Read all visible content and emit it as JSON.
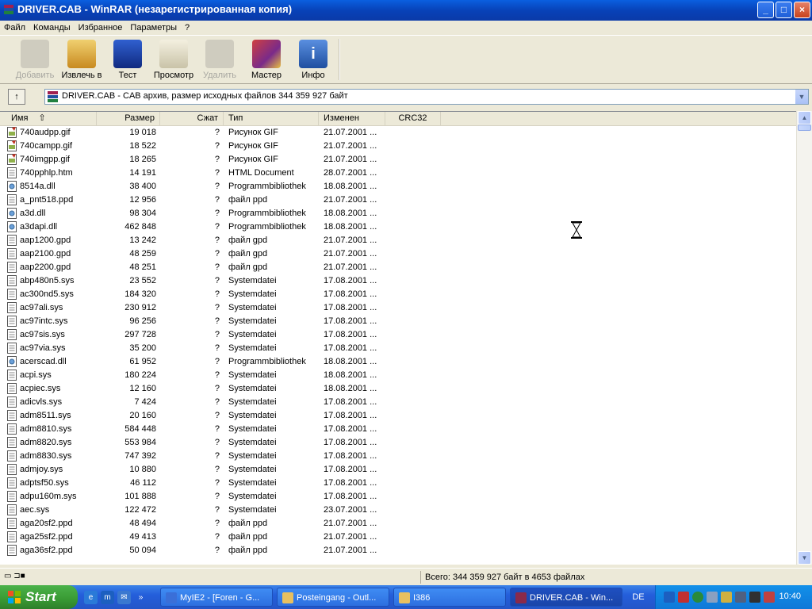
{
  "window": {
    "title": "DRIVER.CAB - WinRAR (незарегистрированная копия)",
    "controls": [
      "_",
      "□",
      "×"
    ]
  },
  "menu": [
    "Файл",
    "Команды",
    "Избранное",
    "Параметры",
    "?"
  ],
  "toolbar": [
    {
      "label": "Добавить",
      "icon": "add-archive-icon",
      "disabled": true,
      "color": "#b8b5a8"
    },
    {
      "label": "Извлечь в",
      "icon": "extract-icon",
      "disabled": false,
      "color": "#d89a2a"
    },
    {
      "label": "Тест",
      "icon": "test-icon",
      "disabled": false,
      "color": "#1a3da8"
    },
    {
      "label": "Просмотр",
      "icon": "view-icon",
      "disabled": false,
      "color": "#c9c3a8"
    },
    {
      "label": "Удалить",
      "icon": "delete-icon",
      "disabled": true,
      "color": "#b8b5a8"
    },
    {
      "label": "Мастер",
      "icon": "wizard-icon",
      "disabled": false,
      "color": "#7a2a8a"
    },
    {
      "label": "Инфо",
      "icon": "info-icon",
      "disabled": false,
      "color": "#2a5fb0"
    }
  ],
  "address": {
    "text": "DRIVER.CAB - CAB архив, размер исходных файлов 344 359 927 байт"
  },
  "columns": [
    "Имя",
    "Размер",
    "Сжат",
    "Тип",
    "Изменен",
    "CRC32"
  ],
  "files": [
    {
      "name": "740audpp.gif",
      "size": "19 018",
      "packed": "?",
      "type": "Рисунок GIF",
      "date": "21.07.2001 ...",
      "kind": "gif"
    },
    {
      "name": "740campp.gif",
      "size": "18 522",
      "packed": "?",
      "type": "Рисунок GIF",
      "date": "21.07.2001 ...",
      "kind": "gif"
    },
    {
      "name": "740imgpp.gif",
      "size": "18 265",
      "packed": "?",
      "type": "Рисунок GIF",
      "date": "21.07.2001 ...",
      "kind": "gif"
    },
    {
      "name": "740pphlp.htm",
      "size": "14 191",
      "packed": "?",
      "type": "HTML Document",
      "date": "28.07.2001 ...",
      "kind": "doc"
    },
    {
      "name": "8514a.dll",
      "size": "38 400",
      "packed": "?",
      "type": "Programmbibliothek",
      "date": "18.08.2001 ...",
      "kind": "dll"
    },
    {
      "name": "a_pnt518.ppd",
      "size": "12 956",
      "packed": "?",
      "type": "файл ppd",
      "date": "21.07.2001 ...",
      "kind": "doc"
    },
    {
      "name": "a3d.dll",
      "size": "98 304",
      "packed": "?",
      "type": "Programmbibliothek",
      "date": "18.08.2001 ...",
      "kind": "dll"
    },
    {
      "name": "a3dapi.dll",
      "size": "462 848",
      "packed": "?",
      "type": "Programmbibliothek",
      "date": "18.08.2001 ...",
      "kind": "dll"
    },
    {
      "name": "aap1200.gpd",
      "size": "13 242",
      "packed": "?",
      "type": "файл gpd",
      "date": "21.07.2001 ...",
      "kind": "doc"
    },
    {
      "name": "aap2100.gpd",
      "size": "48 259",
      "packed": "?",
      "type": "файл gpd",
      "date": "21.07.2001 ...",
      "kind": "doc"
    },
    {
      "name": "aap2200.gpd",
      "size": "48 251",
      "packed": "?",
      "type": "файл gpd",
      "date": "21.07.2001 ...",
      "kind": "doc"
    },
    {
      "name": "abp480n5.sys",
      "size": "23 552",
      "packed": "?",
      "type": "Systemdatei",
      "date": "17.08.2001 ...",
      "kind": "doc"
    },
    {
      "name": "ac300nd5.sys",
      "size": "184 320",
      "packed": "?",
      "type": "Systemdatei",
      "date": "17.08.2001 ...",
      "kind": "doc"
    },
    {
      "name": "ac97ali.sys",
      "size": "230 912",
      "packed": "?",
      "type": "Systemdatei",
      "date": "17.08.2001 ...",
      "kind": "doc"
    },
    {
      "name": "ac97intc.sys",
      "size": "96 256",
      "packed": "?",
      "type": "Systemdatei",
      "date": "17.08.2001 ...",
      "kind": "doc"
    },
    {
      "name": "ac97sis.sys",
      "size": "297 728",
      "packed": "?",
      "type": "Systemdatei",
      "date": "17.08.2001 ...",
      "kind": "doc"
    },
    {
      "name": "ac97via.sys",
      "size": "35 200",
      "packed": "?",
      "type": "Systemdatei",
      "date": "17.08.2001 ...",
      "kind": "doc"
    },
    {
      "name": "acerscad.dll",
      "size": "61 952",
      "packed": "?",
      "type": "Programmbibliothek",
      "date": "18.08.2001 ...",
      "kind": "dll"
    },
    {
      "name": "acpi.sys",
      "size": "180 224",
      "packed": "?",
      "type": "Systemdatei",
      "date": "18.08.2001 ...",
      "kind": "doc"
    },
    {
      "name": "acpiec.sys",
      "size": "12 160",
      "packed": "?",
      "type": "Systemdatei",
      "date": "18.08.2001 ...",
      "kind": "doc"
    },
    {
      "name": "adicvls.sys",
      "size": "7 424",
      "packed": "?",
      "type": "Systemdatei",
      "date": "17.08.2001 ...",
      "kind": "doc"
    },
    {
      "name": "adm8511.sys",
      "size": "20 160",
      "packed": "?",
      "type": "Systemdatei",
      "date": "17.08.2001 ...",
      "kind": "doc"
    },
    {
      "name": "adm8810.sys",
      "size": "584 448",
      "packed": "?",
      "type": "Systemdatei",
      "date": "17.08.2001 ...",
      "kind": "doc"
    },
    {
      "name": "adm8820.sys",
      "size": "553 984",
      "packed": "?",
      "type": "Systemdatei",
      "date": "17.08.2001 ...",
      "kind": "doc"
    },
    {
      "name": "adm8830.sys",
      "size": "747 392",
      "packed": "?",
      "type": "Systemdatei",
      "date": "17.08.2001 ...",
      "kind": "doc"
    },
    {
      "name": "admjoy.sys",
      "size": "10 880",
      "packed": "?",
      "type": "Systemdatei",
      "date": "17.08.2001 ...",
      "kind": "doc"
    },
    {
      "name": "adptsf50.sys",
      "size": "46 112",
      "packed": "?",
      "type": "Systemdatei",
      "date": "17.08.2001 ...",
      "kind": "doc"
    },
    {
      "name": "adpu160m.sys",
      "size": "101 888",
      "packed": "?",
      "type": "Systemdatei",
      "date": "17.08.2001 ...",
      "kind": "doc"
    },
    {
      "name": "aec.sys",
      "size": "122 472",
      "packed": "?",
      "type": "Systemdatei",
      "date": "23.07.2001 ...",
      "kind": "doc"
    },
    {
      "name": "aga20sf2.ppd",
      "size": "48 494",
      "packed": "?",
      "type": "файл ppd",
      "date": "21.07.2001 ...",
      "kind": "doc"
    },
    {
      "name": "aga25sf2.ppd",
      "size": "49 413",
      "packed": "?",
      "type": "файл ppd",
      "date": "21.07.2001 ...",
      "kind": "doc"
    },
    {
      "name": "aga36sf2.ppd",
      "size": "50 094",
      "packed": "?",
      "type": "файл ppd",
      "date": "21.07.2001 ...",
      "kind": "doc"
    }
  ],
  "status": {
    "right": "Всего: 344 359 927 байт в 4653 файлах"
  },
  "taskbar": {
    "start": "Start",
    "tasks": [
      {
        "label": "MyIE2 - [Foren - G...",
        "active": false,
        "color": "#3a6fd8"
      },
      {
        "label": "Posteingang - Outl...",
        "active": false,
        "color": "#e8c060"
      },
      {
        "label": "I386",
        "active": false,
        "color": "#e8c060"
      },
      {
        "label": "DRIVER.CAB - Win...",
        "active": true,
        "color": "#8a2a4a"
      }
    ],
    "language": "DE",
    "clock": "10:40"
  }
}
